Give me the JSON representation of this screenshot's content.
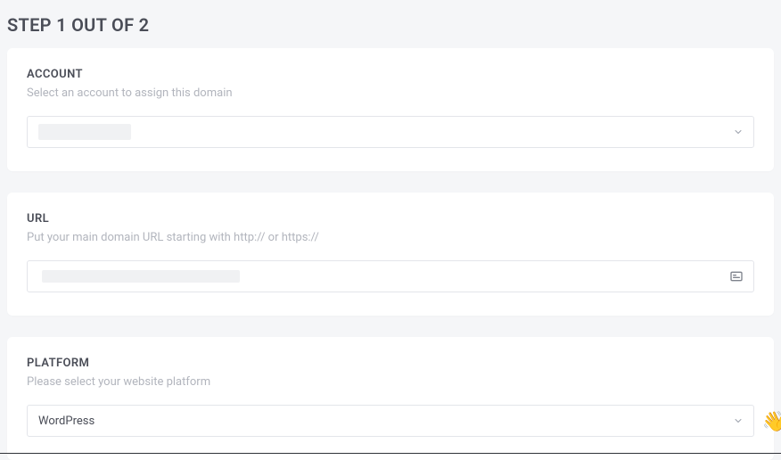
{
  "header": {
    "step_text": "STEP 1 OUT OF 2"
  },
  "account": {
    "title": "ACCOUNT",
    "description": "Select an account to assign this domain",
    "value": ""
  },
  "url": {
    "title": "URL",
    "description": "Put your main domain URL starting with http:// or https://",
    "value": ""
  },
  "platform": {
    "title": "PLATFORM",
    "description": "Please select your website platform",
    "value": "WordPress"
  },
  "wave_glyph": "👋"
}
